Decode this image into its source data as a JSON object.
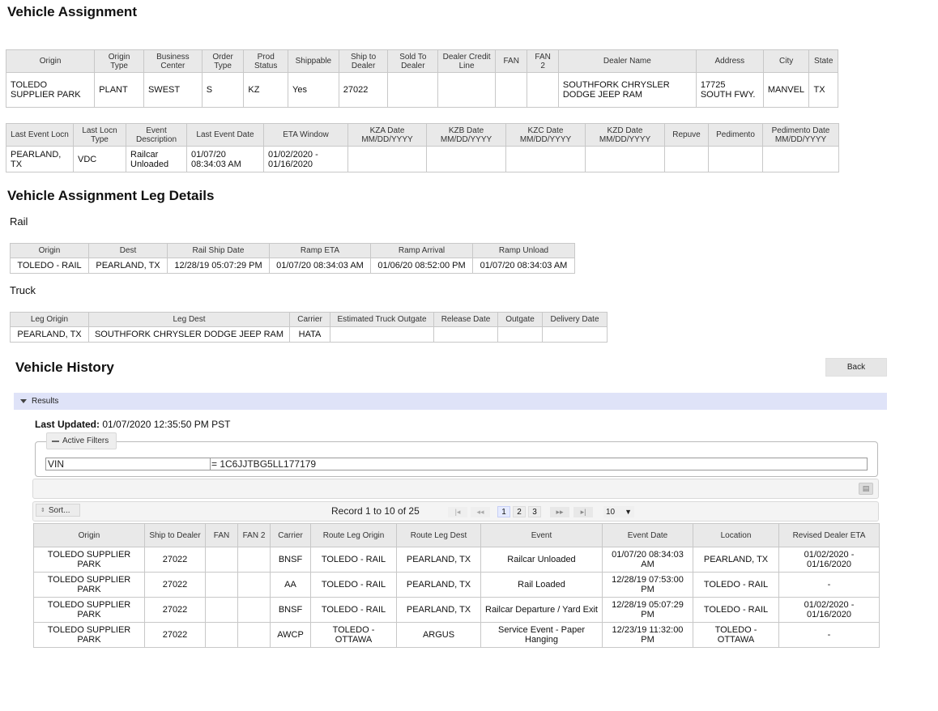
{
  "page_title": "Vehicle Assignment",
  "assignment": {
    "headers": [
      "Origin",
      "Origin Type",
      "Business Center",
      "Order Type",
      "Prod Status",
      "Shippable",
      "Ship to Dealer",
      "Sold To Dealer",
      "Dealer Credit Line",
      "FAN",
      "FAN 2",
      "Dealer Name",
      "Address",
      "City",
      "State"
    ],
    "row": [
      "TOLEDO SUPPLIER PARK",
      "PLANT",
      "SWEST",
      "S",
      "KZ",
      "Yes",
      "27022",
      "",
      "",
      "",
      "",
      "SOUTHFORK CHRYSLER DODGE JEEP RAM",
      "17725 SOUTH FWY.",
      "MANVEL",
      "TX"
    ]
  },
  "events": {
    "headers": [
      "Last Event Locn",
      "Last Locn Type",
      "Event Description",
      "Last Event Date",
      "ETA Window",
      "KZA Date MM/DD/YYYY",
      "KZB Date MM/DD/YYYY",
      "KZC Date MM/DD/YYYY",
      "KZD Date MM/DD/YYYY",
      "Repuve",
      "Pedimento",
      "Pedimento Date MM/DD/YYYY"
    ],
    "row": [
      "PEARLAND, TX",
      "VDC",
      "Railcar Unloaded",
      "01/07/20 08:34:03 AM",
      "01/02/2020 - 01/16/2020",
      "",
      "",
      "",
      "",
      "",
      "",
      ""
    ]
  },
  "leg_details_title": "Vehicle Assignment Leg Details",
  "rail": {
    "title": "Rail",
    "headers": [
      "Origin",
      "Dest",
      "Rail Ship Date",
      "Ramp ETA",
      "Ramp Arrival",
      "Ramp Unload"
    ],
    "row": [
      "TOLEDO - RAIL",
      "PEARLAND, TX",
      "12/28/19 05:07:29 PM",
      "01/07/20 08:34:03 AM",
      "01/06/20 08:52:00 PM",
      "01/07/20 08:34:03 AM"
    ]
  },
  "truck": {
    "title": "Truck",
    "headers": [
      "Leg Origin",
      "Leg Dest",
      "Carrier",
      "Estimated Truck Outgate",
      "Release Date",
      "Outgate",
      "Delivery Date"
    ],
    "row": [
      "PEARLAND, TX",
      "SOUTHFORK CHRYSLER DODGE JEEP RAM",
      "HATA",
      "",
      "",
      "",
      ""
    ]
  },
  "history": {
    "title": "Vehicle History",
    "back_label": "Back",
    "results_label": "Results",
    "last_updated_label": "Last Updated:",
    "last_updated_value": "01/07/2020 12:35:50 PM PST",
    "active_filters_label": "Active Filters",
    "filter_field": "VIN",
    "filter_value": "= 1C6JJTBG5LL177179",
    "sort_label": "Sort...",
    "record_text": "Record 1 to 10 of 25",
    "pages": [
      "1",
      "2",
      "3"
    ],
    "page_size": "10",
    "headers": [
      "Origin",
      "Ship to Dealer",
      "FAN",
      "FAN 2",
      "Carrier",
      "Route Leg Origin",
      "Route Leg Dest",
      "Event",
      "Event Date",
      "Location",
      "Revised Dealer ETA"
    ],
    "rows": [
      [
        "TOLEDO SUPPLIER PARK",
        "27022",
        "",
        "",
        "BNSF",
        "TOLEDO - RAIL",
        "PEARLAND, TX",
        "Railcar Unloaded",
        "01/07/20 08:34:03 AM",
        "PEARLAND, TX",
        "01/02/2020 - 01/16/2020"
      ],
      [
        "TOLEDO SUPPLIER PARK",
        "27022",
        "",
        "",
        "AA",
        "TOLEDO - RAIL",
        "PEARLAND, TX",
        "Rail Loaded",
        "12/28/19 07:53:00 PM",
        "TOLEDO - RAIL",
        "-"
      ],
      [
        "TOLEDO SUPPLIER PARK",
        "27022",
        "",
        "",
        "BNSF",
        "TOLEDO - RAIL",
        "PEARLAND, TX",
        "Railcar Departure / Yard Exit",
        "12/28/19 05:07:29 PM",
        "TOLEDO - RAIL",
        "01/02/2020 - 01/16/2020"
      ],
      [
        "TOLEDO SUPPLIER PARK",
        "27022",
        "",
        "",
        "AWCP",
        "TOLEDO - OTTAWA",
        "ARGUS",
        "Service Event - Paper Hanging",
        "12/23/19 11:32:00 PM",
        "TOLEDO - OTTAWA",
        "-"
      ]
    ]
  }
}
